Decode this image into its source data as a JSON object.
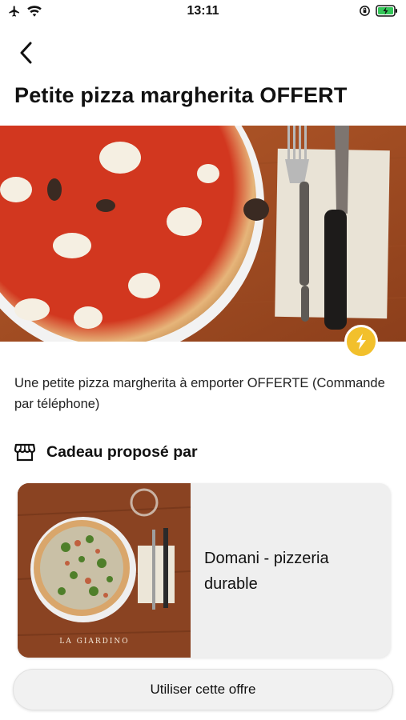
{
  "status_bar": {
    "time": "13:11",
    "left_icons": [
      "airplane-icon",
      "wifi-icon"
    ],
    "right_icons": [
      "orientation-lock-icon",
      "battery-charging-icon"
    ],
    "battery_color": "#34c759"
  },
  "nav": {
    "back_icon": "chevron-left-icon"
  },
  "offer": {
    "title": "Petite pizza margherita OFFERT",
    "description": "Une petite pizza margherita à emporter OFFERTE (Commande par téléphone)",
    "badge_icon": "lightning-icon",
    "badge_color": "#f2c02c"
  },
  "gift_section": {
    "icon": "store-icon",
    "title": "Cadeau proposé par"
  },
  "merchant": {
    "name": "Domani - pizzeria durable",
    "photo_caption": "LA GIARDINO"
  },
  "cta": {
    "label": "Utiliser cette offre"
  }
}
